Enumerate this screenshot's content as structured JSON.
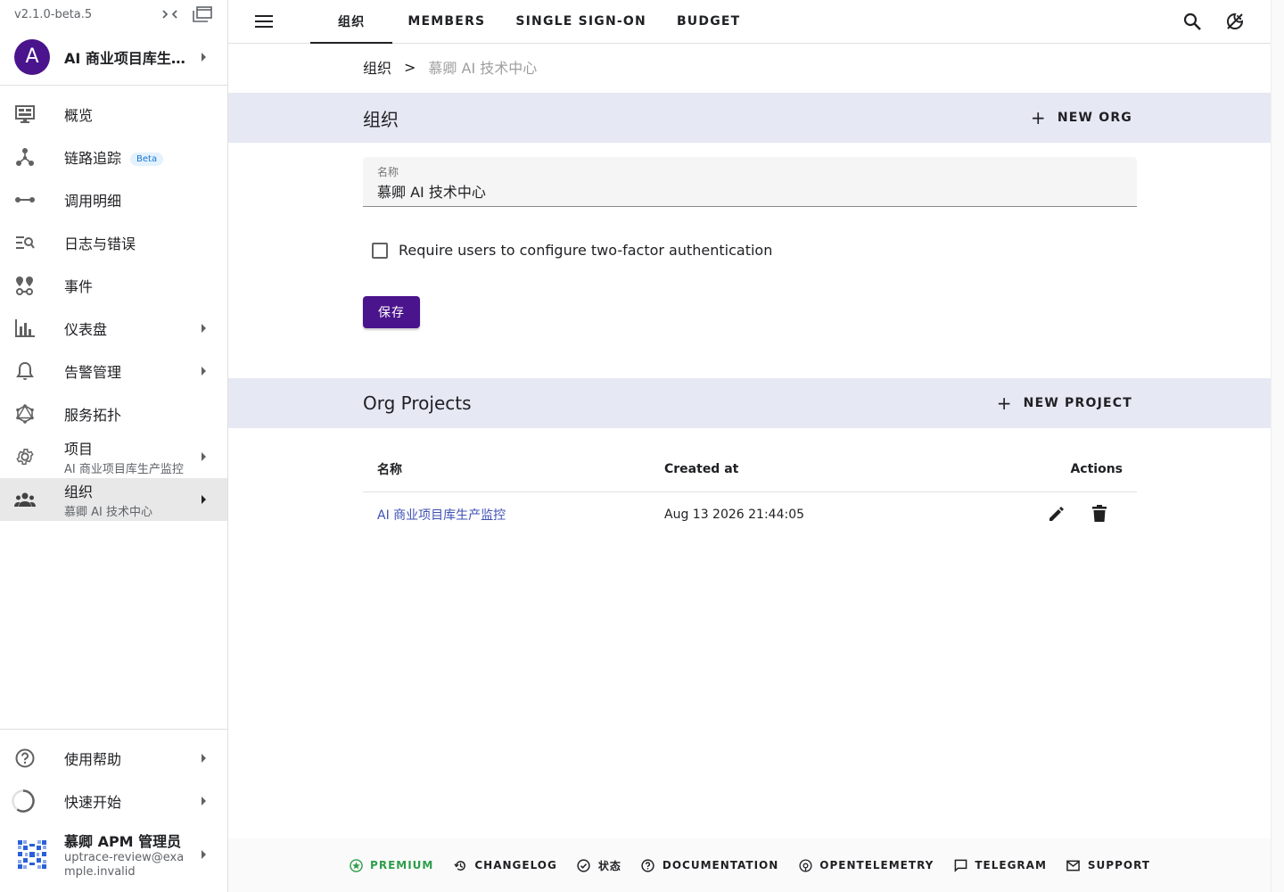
{
  "sidebar": {
    "version": "v2.1.0-beta.5",
    "project": {
      "avatar_letter": "A",
      "name": "AI 商业项目库生产监控"
    },
    "items": [
      {
        "label": "概览",
        "icon": "monitor-dashboard-icon"
      },
      {
        "label": "链路追踪",
        "badge": "Beta",
        "icon": "graph-nodes-icon"
      },
      {
        "label": "调用明细",
        "icon": "span-line-icon"
      },
      {
        "label": "日志与错误",
        "icon": "text-search-icon"
      },
      {
        "label": "事件",
        "icon": "map-markers-icon"
      },
      {
        "label": "仪表盘",
        "icon": "bar-chart-icon"
      },
      {
        "label": "告警管理",
        "icon": "bell-icon"
      },
      {
        "label": "服务拓扑",
        "icon": "graphql-icon"
      },
      {
        "label": "项目",
        "sublabel": "AI 商业项目库生产监控",
        "icon": "gear-icon"
      },
      {
        "label": "组织",
        "sublabel": "慕卿 AI 技术中心",
        "icon": "group-icon"
      }
    ],
    "bottom": {
      "help": "使用帮助",
      "quickstart": "快速开始",
      "user_name": "慕卿 APM 管理员",
      "user_email": "uptrace-review@example.invalid"
    }
  },
  "topbar": {
    "tabs": [
      "组织",
      "MEMBERS",
      "SINGLE SIGN-ON",
      "BUDGET"
    ],
    "active_tab": "组织"
  },
  "breadcrumb": {
    "root": "组织",
    "separator": ">",
    "current": "慕卿 AI 技术中心"
  },
  "org_section": {
    "title": "组织",
    "new_button": "NEW ORG",
    "name_field": {
      "label": "名称",
      "value": "慕卿 AI 技术中心"
    },
    "two_factor": {
      "label": "Require users to configure two-factor authentication",
      "checked": false
    },
    "save_label": "保存"
  },
  "projects_section": {
    "title": "Org Projects",
    "new_button": "NEW PROJECT",
    "columns": [
      "名称",
      "Created at",
      "Actions"
    ],
    "rows": [
      {
        "name": "AI 商业项目库生产监控",
        "created_at": "Aug 13 2026 21:44:05"
      }
    ]
  },
  "footer": {
    "links": [
      "PREMIUM",
      "CHANGELOG",
      "状态",
      "DOCUMENTATION",
      "OPENTELEMETRY",
      "TELEGRAM",
      "SUPPORT"
    ]
  },
  "colors": {
    "brand": "#4a148c",
    "section_bg": "#e6e8f4",
    "link": "#3f51b5",
    "premium": "#2e9d4b"
  }
}
